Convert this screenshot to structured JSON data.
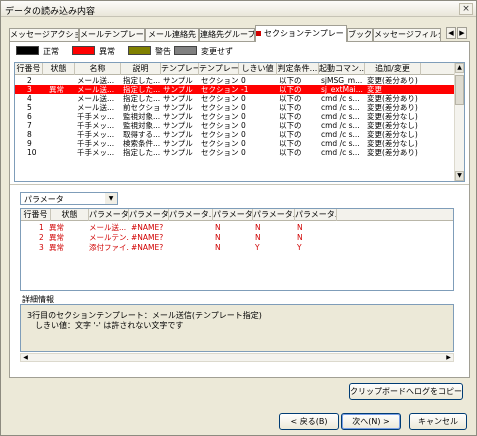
{
  "window": {
    "title": "データの読み込み内容",
    "close_glyph": "×"
  },
  "tabs": [
    {
      "label": "メッセージアクション"
    },
    {
      "label": "メールテンプレート"
    },
    {
      "label": "メール連絡先"
    },
    {
      "label": "連絡先グループ"
    },
    {
      "label": "セクションテンプレート",
      "active": true
    },
    {
      "label": "ブック"
    },
    {
      "label": "メッセージフィルタ"
    }
  ],
  "legend": [
    {
      "label": "正常",
      "color": "#000000"
    },
    {
      "label": "異常",
      "color": "#ff0000"
    },
    {
      "label": "警告",
      "color": "#808000"
    },
    {
      "label": "変更せず",
      "color": "#808080"
    }
  ],
  "main_grid": {
    "headers": [
      "行番号",
      "状態",
      "名称",
      "説明",
      "テンプレー...",
      "テンプレー...",
      "しきい値",
      "判定条件...",
      "起動コマン...",
      "追加/変更"
    ],
    "rows": [
      {
        "no": "2",
        "status": "",
        "name": "メール送...",
        "desc": "指定した...",
        "t1": "サンプル",
        "t2": "セクション...",
        "thr": "0",
        "cond": "以下の",
        "cmd": "sjMSG_m...",
        "mod": "変更(差分あり)",
        "selected": false
      },
      {
        "no": "3",
        "status": "異常",
        "name": "メール送...",
        "desc": "指定した...",
        "t1": "サンプル",
        "t2": "セクション...",
        "thr": "-1",
        "cond": "以下の",
        "cmd": "sj_extMai...",
        "mod": "変更",
        "selected": true
      },
      {
        "no": "4",
        "status": "",
        "name": "メール送...",
        "desc": "指定した...",
        "t1": "サンプル",
        "t2": "セクション...",
        "thr": "0",
        "cond": "以下の",
        "cmd": "cmd /c s...",
        "mod": "変更(差分あり)",
        "selected": false
      },
      {
        "no": "5",
        "status": "",
        "name": "メール送...",
        "desc": "前セクショ...",
        "t1": "サンプル",
        "t2": "セクション...",
        "thr": "0",
        "cond": "以下の",
        "cmd": "cmd /c s...",
        "mod": "変更(差分あり)",
        "selected": false
      },
      {
        "no": "6",
        "status": "",
        "name": "千手メッ...",
        "desc": "監視対象...",
        "t1": "サンプル",
        "t2": "セクション...",
        "thr": "0",
        "cond": "以下の",
        "cmd": "cmd /c s...",
        "mod": "変更(差分なし)",
        "selected": false
      },
      {
        "no": "7",
        "status": "",
        "name": "千手メッ...",
        "desc": "監視対象...",
        "t1": "サンプル",
        "t2": "セクション...",
        "thr": "0",
        "cond": "以下の",
        "cmd": "cmd /c s...",
        "mod": "変更(差分なし)",
        "selected": false
      },
      {
        "no": "8",
        "status": "",
        "name": "千手メッ...",
        "desc": "取得する...",
        "t1": "サンプル",
        "t2": "セクション...",
        "thr": "0",
        "cond": "以下の",
        "cmd": "cmd /c s...",
        "mod": "変更(差分なし)",
        "selected": false
      },
      {
        "no": "9",
        "status": "",
        "name": "千手メッ...",
        "desc": "検索条件...",
        "t1": "サンプル",
        "t2": "セクション...",
        "thr": "0",
        "cond": "以下の",
        "cmd": "cmd /c s...",
        "mod": "変更(差分なし)",
        "selected": false
      },
      {
        "no": "10",
        "status": "",
        "name": "千手メッ...",
        "desc": "指定した...",
        "t1": "サンプル",
        "t2": "セクション...",
        "thr": "0",
        "cond": "以下の",
        "cmd": "cmd /c s...",
        "mod": "変更(差分あり)",
        "selected": false
      }
    ]
  },
  "param_dropdown": {
    "value": "パラメータ",
    "arrow": "▼"
  },
  "param_grid": {
    "headers": [
      "行番号",
      "状態",
      "パラメータ...",
      "パラメータ...",
      "パラメータ...",
      "パラメータ...",
      "パラメータ...",
      "パラメータ..."
    ],
    "rows": [
      {
        "no": "1",
        "status": "異常",
        "p1": "メール送...",
        "p2": "#NAME?",
        "p3": "",
        "p4": "N",
        "p5": "N",
        "p6": "N"
      },
      {
        "no": "2",
        "status": "異常",
        "p1": "メールテン...",
        "p2": "#NAME?",
        "p3": "",
        "p4": "N",
        "p5": "N",
        "p6": "N"
      },
      {
        "no": "3",
        "status": "異常",
        "p1": "添付ファイ...",
        "p2": "#NAME?",
        "p3": "",
        "p4": "N",
        "p5": "Y",
        "p6": "Y"
      }
    ]
  },
  "details": {
    "label": "詳細情報",
    "lines": [
      "3行目のセクションテンプレート：メール送信(テンプレート指定)",
      "　しきい値：文字 '-' は許されない文字です"
    ]
  },
  "buttons": {
    "copy": "クリップボードへログをコピー",
    "back": "< 戻る(B)",
    "next": "次へ(N) >",
    "cancel": "キャンセル"
  }
}
